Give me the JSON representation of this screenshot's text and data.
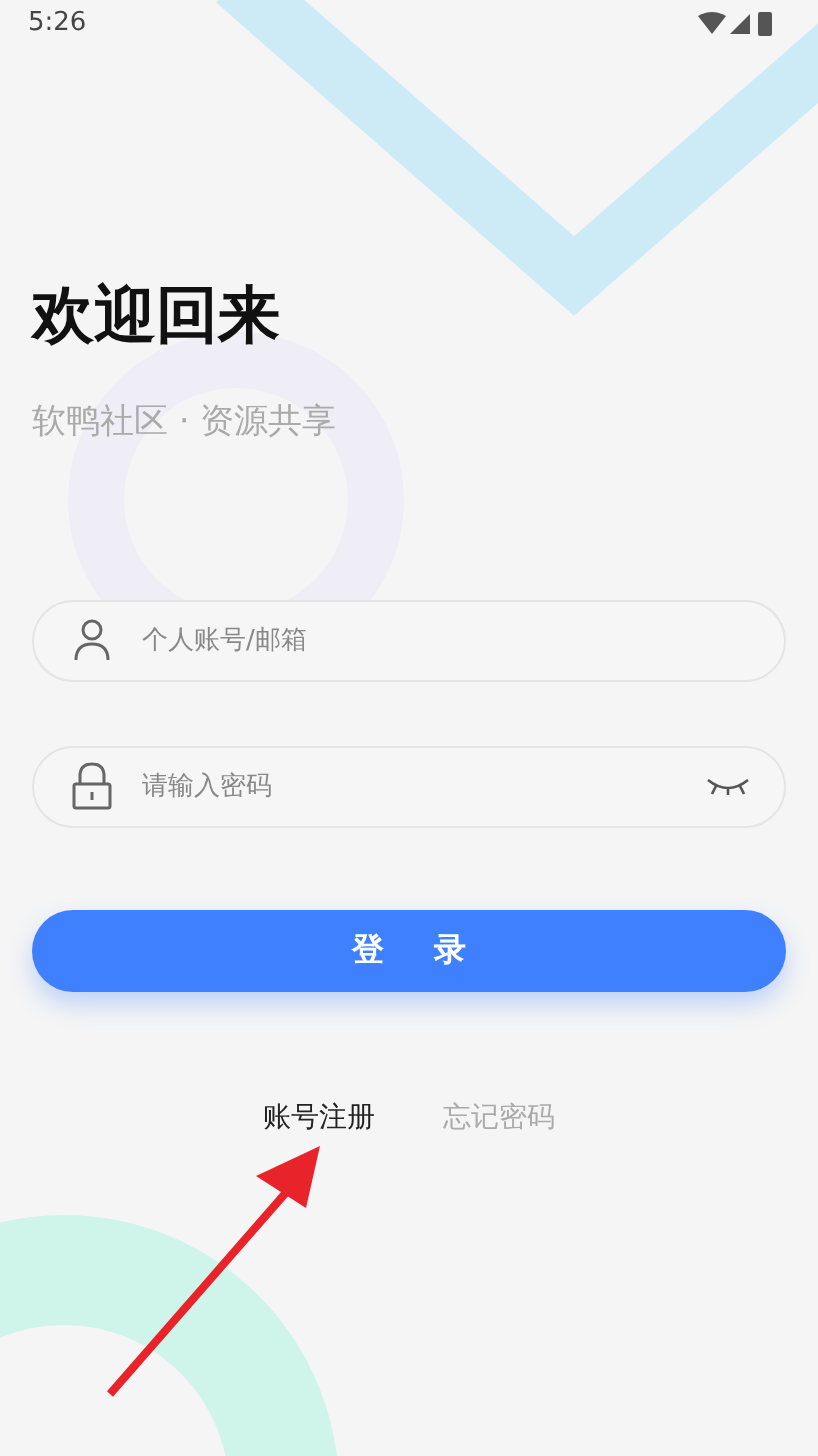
{
  "status_bar": {
    "time": "5:26"
  },
  "title": "欢迎回来",
  "subtitle": "软鸭社区 · 资源共享",
  "fields": [
    {
      "kind": "account",
      "placeholder": "个人账号/邮箱"
    },
    {
      "kind": "password",
      "placeholder": "请输入密码"
    }
  ],
  "login_button": "登 录",
  "links": [
    {
      "label": "账号注册",
      "muted": false
    },
    {
      "label": "忘记密码",
      "muted": true
    }
  ]
}
